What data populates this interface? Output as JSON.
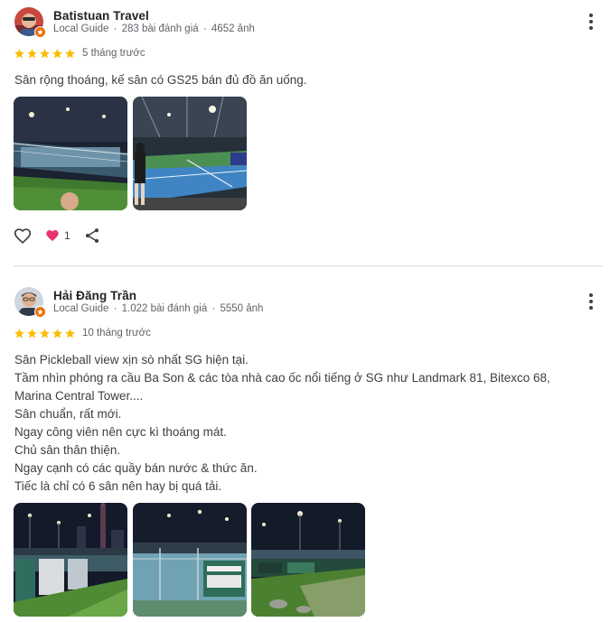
{
  "reviews": [
    {
      "author": "Batistuan Travel",
      "badge": "Local Guide",
      "reviews_count": "283 bài đánh giá",
      "photos_count": "4652 ảnh",
      "rating": 5,
      "time_ago": "5 tháng trước",
      "lines": [
        "Sân rộng thoáng, kế sân có GS25 bán đủ đồ ăn uống."
      ],
      "photos": [
        "court-photo-night-overview",
        "court-photo-blue-court"
      ],
      "reactions": {
        "heart_count": "1"
      }
    },
    {
      "author": "Hải Đăng Trần",
      "badge": "Local Guide",
      "reviews_count": "1.022 bài đánh giá",
      "photos_count": "5550 ảnh",
      "rating": 5,
      "time_ago": "10 tháng trước",
      "lines": [
        "Sân Pickleball view xịn sò nhất SG hiện tại.",
        "Tầm nhìn phóng ra cầu Ba Son & các tòa nhà cao ốc nổi tiếng ở SG như Landmark 81, Bitexco 68,",
        "Marina Central Tower....",
        "Sân chuẩn, rất mới.",
        "Ngay công viên nên cực kì thoáng mát.",
        "Chủ sân thân thiện.",
        "Ngay cạnh có các quầy bán nước & thức ăn.",
        "Tiếc là chỉ có 6 sân nên hay bị quá tải."
      ],
      "photos": [
        "court-photo-night-skyline",
        "court-photo-fence-banners",
        "court-photo-park-lights"
      ]
    }
  ],
  "colors": {
    "star": "#fbbc04",
    "badge": "#e8710a",
    "heart": "#e8336d",
    "meta": "#5f6368"
  },
  "icons": [
    "more-vert-icon",
    "star-icon",
    "thumb-like-icon",
    "heart-reaction-icon",
    "share-icon",
    "local-guide-badge-icon"
  ]
}
